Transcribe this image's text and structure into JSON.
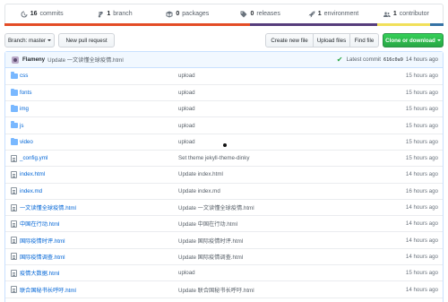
{
  "stats": {
    "commits": {
      "count": "16",
      "label": "commits",
      "icon": "history-icon"
    },
    "branches": {
      "count": "1",
      "label": "branch",
      "icon": "branch-icon"
    },
    "packages": {
      "count": "0",
      "label": "packages",
      "icon": "package-icon"
    },
    "releases": {
      "count": "0",
      "label": "releases",
      "icon": "tag-icon"
    },
    "environments": {
      "count": "1",
      "label": "environment",
      "icon": "rocket-icon"
    },
    "contributors": {
      "count": "1",
      "label": "contributor",
      "icon": "people-icon"
    }
  },
  "language_bar": [
    "#e34c26",
    "#563d7c",
    "#f1e05a",
    "#3572A5"
  ],
  "toolbar": {
    "branch_label": "Branch: master",
    "new_pr": "New pull request",
    "create_file": "Create new file",
    "upload_files": "Upload files",
    "find_file": "Find file",
    "clone": "Clone or download"
  },
  "latest_commit": {
    "author": "Flameny",
    "message": "Update 一文读懂全球疫情.html",
    "prefix": "Latest commit",
    "sha": "616c0a9",
    "age": "14 hours ago"
  },
  "files": [
    {
      "type": "dir",
      "name": "css",
      "message": "upload",
      "age": "15 hours ago"
    },
    {
      "type": "dir",
      "name": "fonts",
      "message": "upload",
      "age": "15 hours ago"
    },
    {
      "type": "dir",
      "name": "img",
      "message": "upload",
      "age": "15 hours ago"
    },
    {
      "type": "dir",
      "name": "js",
      "message": "upload",
      "age": "15 hours ago"
    },
    {
      "type": "dir",
      "name": "video",
      "message": "upload",
      "age": "15 hours ago"
    },
    {
      "type": "file",
      "name": "_config.yml",
      "message": "Set theme jekyll-theme-dinky",
      "age": "15 hours ago"
    },
    {
      "type": "file",
      "name": "index.html",
      "message": "Update index.html",
      "age": "14 hours ago"
    },
    {
      "type": "file",
      "name": "index.md",
      "message": "Update index.md",
      "age": "16 hours ago"
    },
    {
      "type": "file",
      "name": "一文读懂全球疫情.html",
      "message": "Update 一文读懂全球疫情.html",
      "age": "14 hours ago"
    },
    {
      "type": "file",
      "name": "中国在行动.html",
      "message": "Update 中国在行动.html",
      "age": "14 hours ago"
    },
    {
      "type": "file",
      "name": "国际疫情时评.html",
      "message": "Update 国际疫情时评.html",
      "age": "14 hours ago"
    },
    {
      "type": "file",
      "name": "国际疫情调查.html",
      "message": "Update 国际疫情调查.html",
      "age": "14 hours ago"
    },
    {
      "type": "file",
      "name": "疫情大数据.html",
      "message": "upload",
      "age": "15 hours ago"
    },
    {
      "type": "file",
      "name": "联合国秘书长呼吁.html",
      "message": "Update 联合国秘书长呼吁.html",
      "age": "14 hours ago"
    }
  ]
}
